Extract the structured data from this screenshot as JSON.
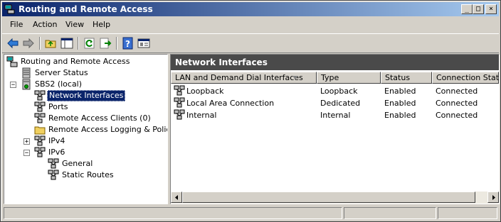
{
  "window": {
    "title": "Routing and Remote Access"
  },
  "menu": [
    "File",
    "Action",
    "View",
    "Help"
  ],
  "toolbar": {
    "buttons": [
      "back-icon",
      "forward-icon",
      "up-folder-icon",
      "show-hide-tree-icon",
      "refresh-icon",
      "export-list-icon",
      "help-icon",
      "properties-icon"
    ]
  },
  "tree": {
    "root": "Routing and Remote Access",
    "server_status": "Server Status",
    "server": "SBS2 (local)",
    "network_interfaces": "Network Interfaces",
    "ports": "Ports",
    "remote_access_clients": "Remote Access Clients (0)",
    "logging": "Remote Access Logging & Policies",
    "ipv4": "IPv4",
    "ipv6": "IPv6",
    "general": "General",
    "static_routes": "Static Routes"
  },
  "detail": {
    "header": "Network Interfaces",
    "columns": [
      "LAN and Demand Dial Interfaces",
      "Type",
      "Status",
      "Connection State"
    ],
    "rows": [
      [
        "Loopback",
        "Loopback",
        "Enabled",
        "Connected"
      ],
      [
        "Local Area Connection",
        "Dedicated",
        "Enabled",
        "Connected"
      ],
      [
        "Internal",
        "Internal",
        "Enabled",
        "Connected"
      ]
    ]
  },
  "colors": {
    "titlebar_start": "#0a246a",
    "titlebar_end": "#a6caf0",
    "pane_header": "#4a4a4a",
    "selection": "#0a246a"
  }
}
